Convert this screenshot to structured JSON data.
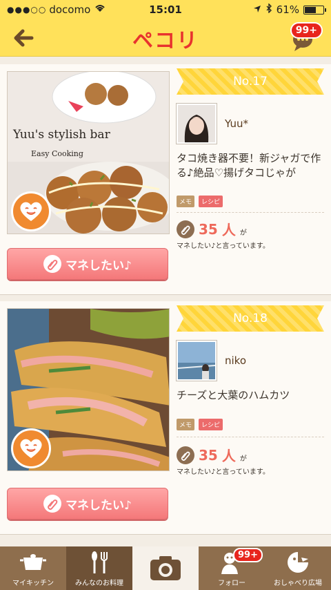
{
  "status_bar": {
    "carrier": "docomo",
    "time": "15:01",
    "battery": "61%",
    "battery_level": 0.61
  },
  "header": {
    "logo": "ペコリ",
    "notification_count": "99+"
  },
  "feed": [
    {
      "rank": "No.17",
      "photo_caption_1": "Yuu's stylish bar",
      "photo_caption_2": "Easy Cooking",
      "username": "Yuu*",
      "title": "タコ焼き器不要！新ジャガで作る♪絶品♡揚げタコじゃが",
      "tag_memo": "メモ",
      "tag_recipe": "レシピ",
      "count": "35",
      "count_unit": "人",
      "count_ga": "が",
      "count_text": "マネしたい♪と言っています。",
      "button_label": "マネしたい♪"
    },
    {
      "rank": "No.18",
      "username": "niko",
      "title": "チーズと大葉のハムカツ",
      "tag_memo": "メモ",
      "tag_recipe": "レシピ",
      "count": "35",
      "count_unit": "人",
      "count_ga": "が",
      "count_text": "マネしたい♪と言っています。",
      "button_label": "マネしたい♪"
    }
  ],
  "tabbar": {
    "items": [
      {
        "label": "マイキッチン",
        "icon": "pot-icon"
      },
      {
        "label": "みんなのお料理",
        "icon": "utensils-icon"
      },
      {
        "label": "",
        "icon": "camera-icon"
      },
      {
        "label": "フォロー",
        "icon": "follow-icon",
        "badge": "99+"
      },
      {
        "label": "おしゃべり広場",
        "icon": "chat-face-icon"
      }
    ]
  },
  "colors": {
    "header": "#ffe15a",
    "accent_red": "#e8322e",
    "button_pink": "#f4787a",
    "tabbar": "#8e6e4d"
  }
}
